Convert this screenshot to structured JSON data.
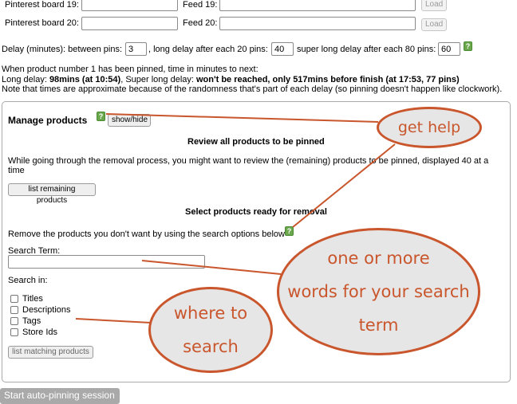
{
  "boards": [
    {
      "board_label": "Pinterest board 19:",
      "board_value": "",
      "feed_label": "Feed 19:",
      "feed_value": "",
      "load_label": "Load"
    },
    {
      "board_label": "Pinterest board 20:",
      "board_value": "",
      "feed_label": "Feed 20:",
      "feed_value": "",
      "load_label": "Load"
    }
  ],
  "delay": {
    "label_start": "Delay (minutes): between pins:",
    "between_value": "3",
    "label_long": ", long delay after each 20 pins:",
    "long_value": "40",
    "label_super": "super long delay after each 80 pins:",
    "super_value": "60"
  },
  "info": {
    "line1": "When product number 1 has been pinned, time in minutes to next:",
    "long_prefix": "Long delay: ",
    "long_value": "98mins (at 10:54)",
    "super_prefix": ", Super long delay: ",
    "super_value": "won't be reached, only 517mins before finish (at 17:53, 77 pins)",
    "note": "Note that times are approximate because of the randomness that's part of each delay (so pinning doesn't happen like clockwork)."
  },
  "manage": {
    "title": "Manage products",
    "help_glyph": "?",
    "showhide_label": "show/hide",
    "review_heading": "Review all products to be pinned",
    "review_desc_line1": "While going through the removal process, you might want to review the (remaining) products to be pinned, displayed 40 at a",
    "review_desc_line2": "time",
    "list_remaining_label": "list remaining products",
    "select_heading": "Select products ready for removal",
    "remove_desc": "Remove the products you don't want by using the search options below",
    "search_term_label": "Search Term:",
    "search_value": "",
    "search_in_label": "Search in:",
    "options": [
      {
        "label": "Titles",
        "checked": false
      },
      {
        "label": "Descriptions",
        "checked": false
      },
      {
        "label": "Tags",
        "checked": false
      },
      {
        "label": "Store Ids",
        "checked": false
      }
    ],
    "list_matching_label": "list matching products"
  },
  "start_button_label": "Start auto-pinning session",
  "annotations": {
    "get_help": "get help",
    "search_term_line1": "one or more",
    "search_term_line2": "words for your search",
    "search_term_line3": "term",
    "where_line1": "where to",
    "where_line2": "search"
  },
  "colors": {
    "annotation": "#c9562c",
    "bubble_fill": "#e6e6e6",
    "help_badge": "#6aa74d"
  }
}
